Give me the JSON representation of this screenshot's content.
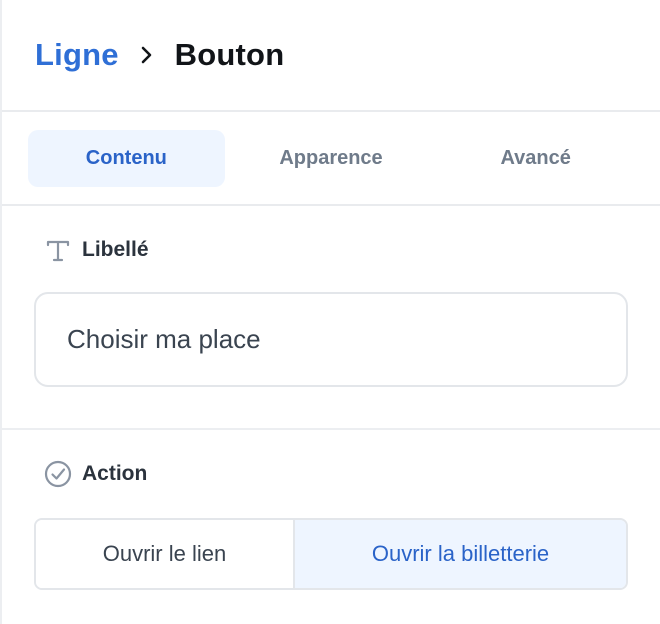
{
  "breadcrumb": {
    "parent": "Ligne",
    "current": "Bouton"
  },
  "tabs": [
    {
      "label": "Contenu",
      "active": true
    },
    {
      "label": "Apparence",
      "active": false
    },
    {
      "label": "Avancé",
      "active": false
    }
  ],
  "label_section": {
    "title": "Libellé",
    "icon": "text-icon",
    "value": "Choisir ma place"
  },
  "action_section": {
    "title": "Action",
    "icon": "check-circle-icon",
    "options": [
      {
        "label": "Ouvrir le lien",
        "selected": false
      },
      {
        "label": "Ouvrir la billetterie",
        "selected": true
      }
    ]
  },
  "colors": {
    "accent": "#2f6fd6",
    "active_bg": "#eef5ff",
    "border": "#e3e6ea"
  }
}
